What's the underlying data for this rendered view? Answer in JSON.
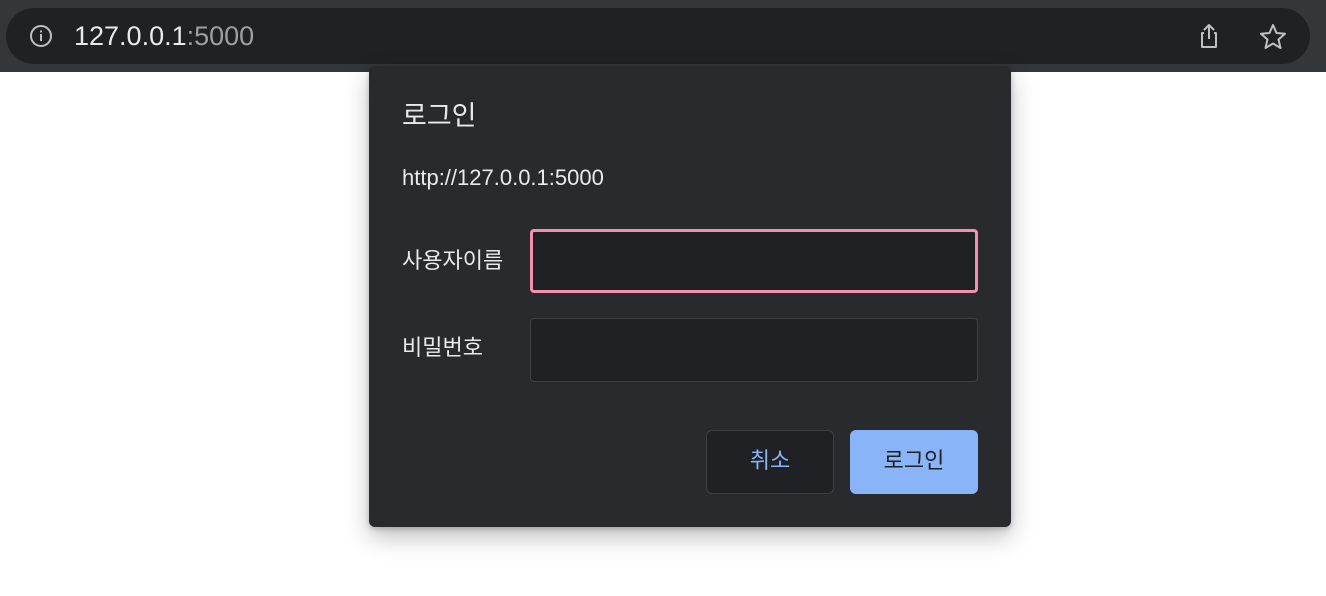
{
  "browser": {
    "url_host": "127.0.0.1",
    "url_port": ":5000",
    "icons": {
      "info": "info-icon",
      "share": "share-icon",
      "bookmark": "star-icon"
    }
  },
  "dialog": {
    "title": "로그인",
    "origin": "http://127.0.0.1:5000",
    "username_label": "사용자이름",
    "username_value": "",
    "password_label": "비밀번호",
    "password_value": "",
    "cancel_label": "취소",
    "login_label": "로그인"
  },
  "colors": {
    "toolbar_bg": "#35363a",
    "omnibox_bg": "#202124",
    "dialog_bg": "#292a2d",
    "focus_border": "#f48fb1",
    "accent": "#8ab4f8"
  }
}
